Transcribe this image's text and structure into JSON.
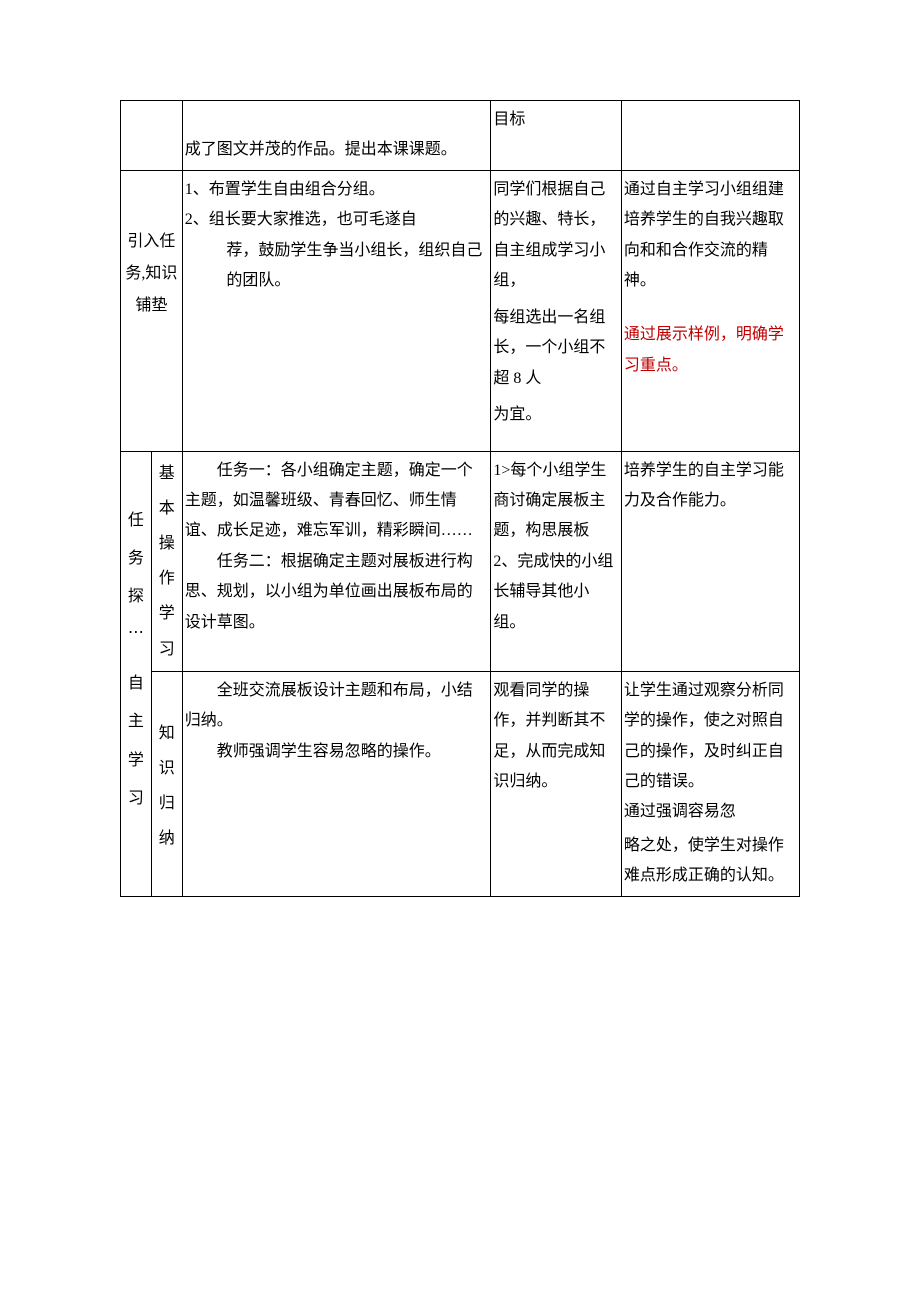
{
  "row1": {
    "col2": "成了图文并茂的作品。提出本课课题。",
    "col3": "目标"
  },
  "row2": {
    "col1": "引入任务,知识铺垫",
    "col2_item1": "1、布置学生自由组合分组。",
    "col2_item2": "2、组长要大家推选，也可毛遂自",
    "col2_item2b": "荐，鼓励学生争当小组长，组织自己的团队。",
    "col3_p1": "同学们根据自己的兴趣、特长，自主组成学习小组，",
    "col3_p2": "每组选出一名组长，一个小组不超 8 人",
    "col3_p3": "为宜。",
    "col4_p1": "通过自主学习小组组建培养学生的自我兴趣取向和和合作交流的精神。",
    "col4_p2a": "通过展示样例，明确学习重点。"
  },
  "row3": {
    "col1a": "任务探",
    "col1a_dots": "⋯",
    "col1a2": "自主学习",
    "col1b": "基本操作学习",
    "col2_p1": "任务一：各小组确定主题，确定一个主题，如温馨班级、青春回忆、师生情谊、成长足迹，难忘军训，精彩瞬间……",
    "col2_p2": "任务二：根据确定主题对展板进行构思、规划，以小组为单位画出展板布局的设计草图。",
    "col3_p1": "1>每个小组学生商讨确定展板主题，构思展板",
    "col3_p2": "2、完成快的小组长辅导其他小组。",
    "col4": "培养学生的自主学习能力及合作能力。"
  },
  "row4": {
    "col1b": "知识归纳",
    "col2_p1": "全班交流展板设计主题和布局，小结归纳。",
    "col2_p2": "教师强调学生容易忽略的操作。",
    "col3": "观看同学的操作，并判断其不足，从而完成知识归纳。",
    "col4_p1": "让学生通过观察分析同学的操作，使之对照自己的操作，及时纠正自己的错误。",
    "col4_p2": "通过强调容易忽",
    "col4_p3": "略之处，使学生对操作难点形成正确的认知。"
  }
}
